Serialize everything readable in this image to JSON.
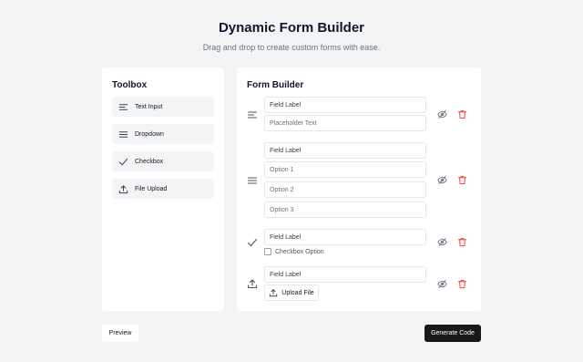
{
  "header": {
    "title": "Dynamic Form Builder",
    "subtitle": "Drag and drop to create custom forms with ease."
  },
  "toolbox": {
    "title": "Toolbox",
    "items": [
      {
        "label": "Text Input",
        "icon": "align-left-icon"
      },
      {
        "label": "Dropdown",
        "icon": "menu-icon"
      },
      {
        "label": "Checkbox",
        "icon": "check-icon"
      },
      {
        "label": "File Upload",
        "icon": "upload-icon"
      }
    ]
  },
  "builder": {
    "title": "Form Builder",
    "fields": [
      {
        "type": "text",
        "label_placeholder": "Field Label",
        "placeholder_placeholder": "Placeholder Text"
      },
      {
        "type": "dropdown",
        "label_placeholder": "Field Label",
        "options": [
          "Option 1",
          "Option 2",
          "Option 3"
        ]
      },
      {
        "type": "checkbox",
        "label_placeholder": "Field Label",
        "checkbox_label": "Checkbox Option"
      },
      {
        "type": "file",
        "label_placeholder": "Field Label",
        "upload_label": "Upload File"
      }
    ]
  },
  "footer": {
    "preview_label": "Preview",
    "generate_label": "Generate Code"
  },
  "colors": {
    "background": "#f3f4f6",
    "card": "#ffffff",
    "accent_dark": "#18181b",
    "delete_red": "#ef4444"
  }
}
